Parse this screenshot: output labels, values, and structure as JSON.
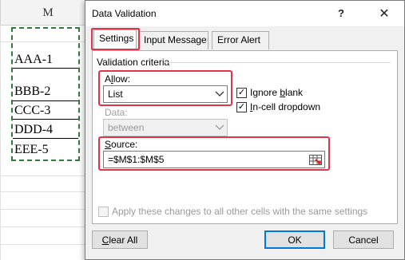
{
  "spreadsheet": {
    "column_header": "M",
    "cells": [
      "AAA-1",
      "BBB-2",
      "CCC-3",
      "DDD-4",
      "EEE-5"
    ]
  },
  "dialog": {
    "title": "Data Validation",
    "help_label": "?",
    "close_label": "✕",
    "tabs": [
      {
        "label": "Settings",
        "active": true
      },
      {
        "label": "Input Message",
        "active": false
      },
      {
        "label": "Error Alert",
        "active": false
      }
    ],
    "group_label": "Validation criteria",
    "allow": {
      "label_prefix": "A",
      "label_mnemonic": "l",
      "label_rest": "low:",
      "value": "List"
    },
    "ignore_blank": {
      "prefix": "Ignore ",
      "mnemonic": "b",
      "rest": "lank",
      "checked": true
    },
    "in_cell_dropdown": {
      "prefix": "",
      "mnemonic": "I",
      "rest": "n-cell dropdown",
      "checked": true
    },
    "data": {
      "label": "Data:",
      "value": "between"
    },
    "source": {
      "label_mnemonic": "S",
      "label_rest": "ource:",
      "value": "=$M$1:$M$5"
    },
    "apply_all": {
      "label": "Apply these changes to all other cells with the same settings",
      "checked": false
    },
    "buttons": {
      "clear_all_mnemonic": "C",
      "clear_all_rest": "lear All",
      "ok": "OK",
      "cancel": "Cancel"
    },
    "highlight_color": "#e0344b",
    "check_mark": "✓"
  }
}
